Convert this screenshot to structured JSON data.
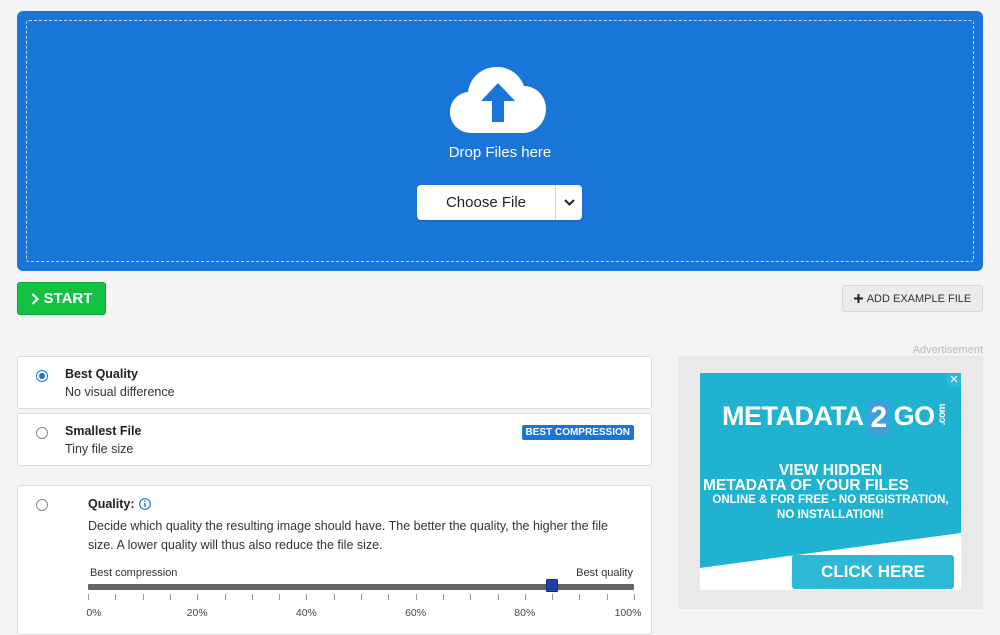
{
  "dropzone": {
    "text": "Drop Files here",
    "choose_label": "Choose File"
  },
  "actions": {
    "start_label": "START",
    "add_example_label": "ADD EXAMPLE FILE"
  },
  "options": [
    {
      "title": "Best Quality",
      "subtitle": "No visual difference",
      "selected": true
    },
    {
      "title": "Smallest File",
      "subtitle": "Tiny file size",
      "badge": "BEST COMPRESSION",
      "selected": false
    }
  ],
  "quality": {
    "title": "Quality:",
    "description": "Decide which quality the resulting image should have. The better the quality, the higher the file size. A lower quality will thus also reduce the file size.",
    "left_label": "Best compression",
    "right_label": "Best quality",
    "value_percent": 85,
    "tick_labels": [
      "0%",
      "20%",
      "40%",
      "60%",
      "80%",
      "100%"
    ]
  },
  "ad": {
    "label": "Advertisement",
    "brand_left": "METADATA",
    "brand_num": "2",
    "brand_right": "GO",
    "brand_suffix": ".com",
    "headline_1": "VIEW HIDDEN",
    "headline_2": "METADATA OF YOUR FILES",
    "sub_1": "ONLINE & FOR FREE - NO REGISTRATION,",
    "sub_2": "NO INSTALLATION!",
    "cta": "CLICK HERE",
    "close": "✕"
  },
  "colors": {
    "primary": "#1a75d9",
    "start": "#13c243",
    "ad_teal": "#2db8d6"
  },
  "icons": {
    "upload": "cloud-upload-icon",
    "caret": "chevron-down-icon",
    "start": "chevron-right-icon",
    "add": "plus-icon",
    "info": "info-icon"
  }
}
